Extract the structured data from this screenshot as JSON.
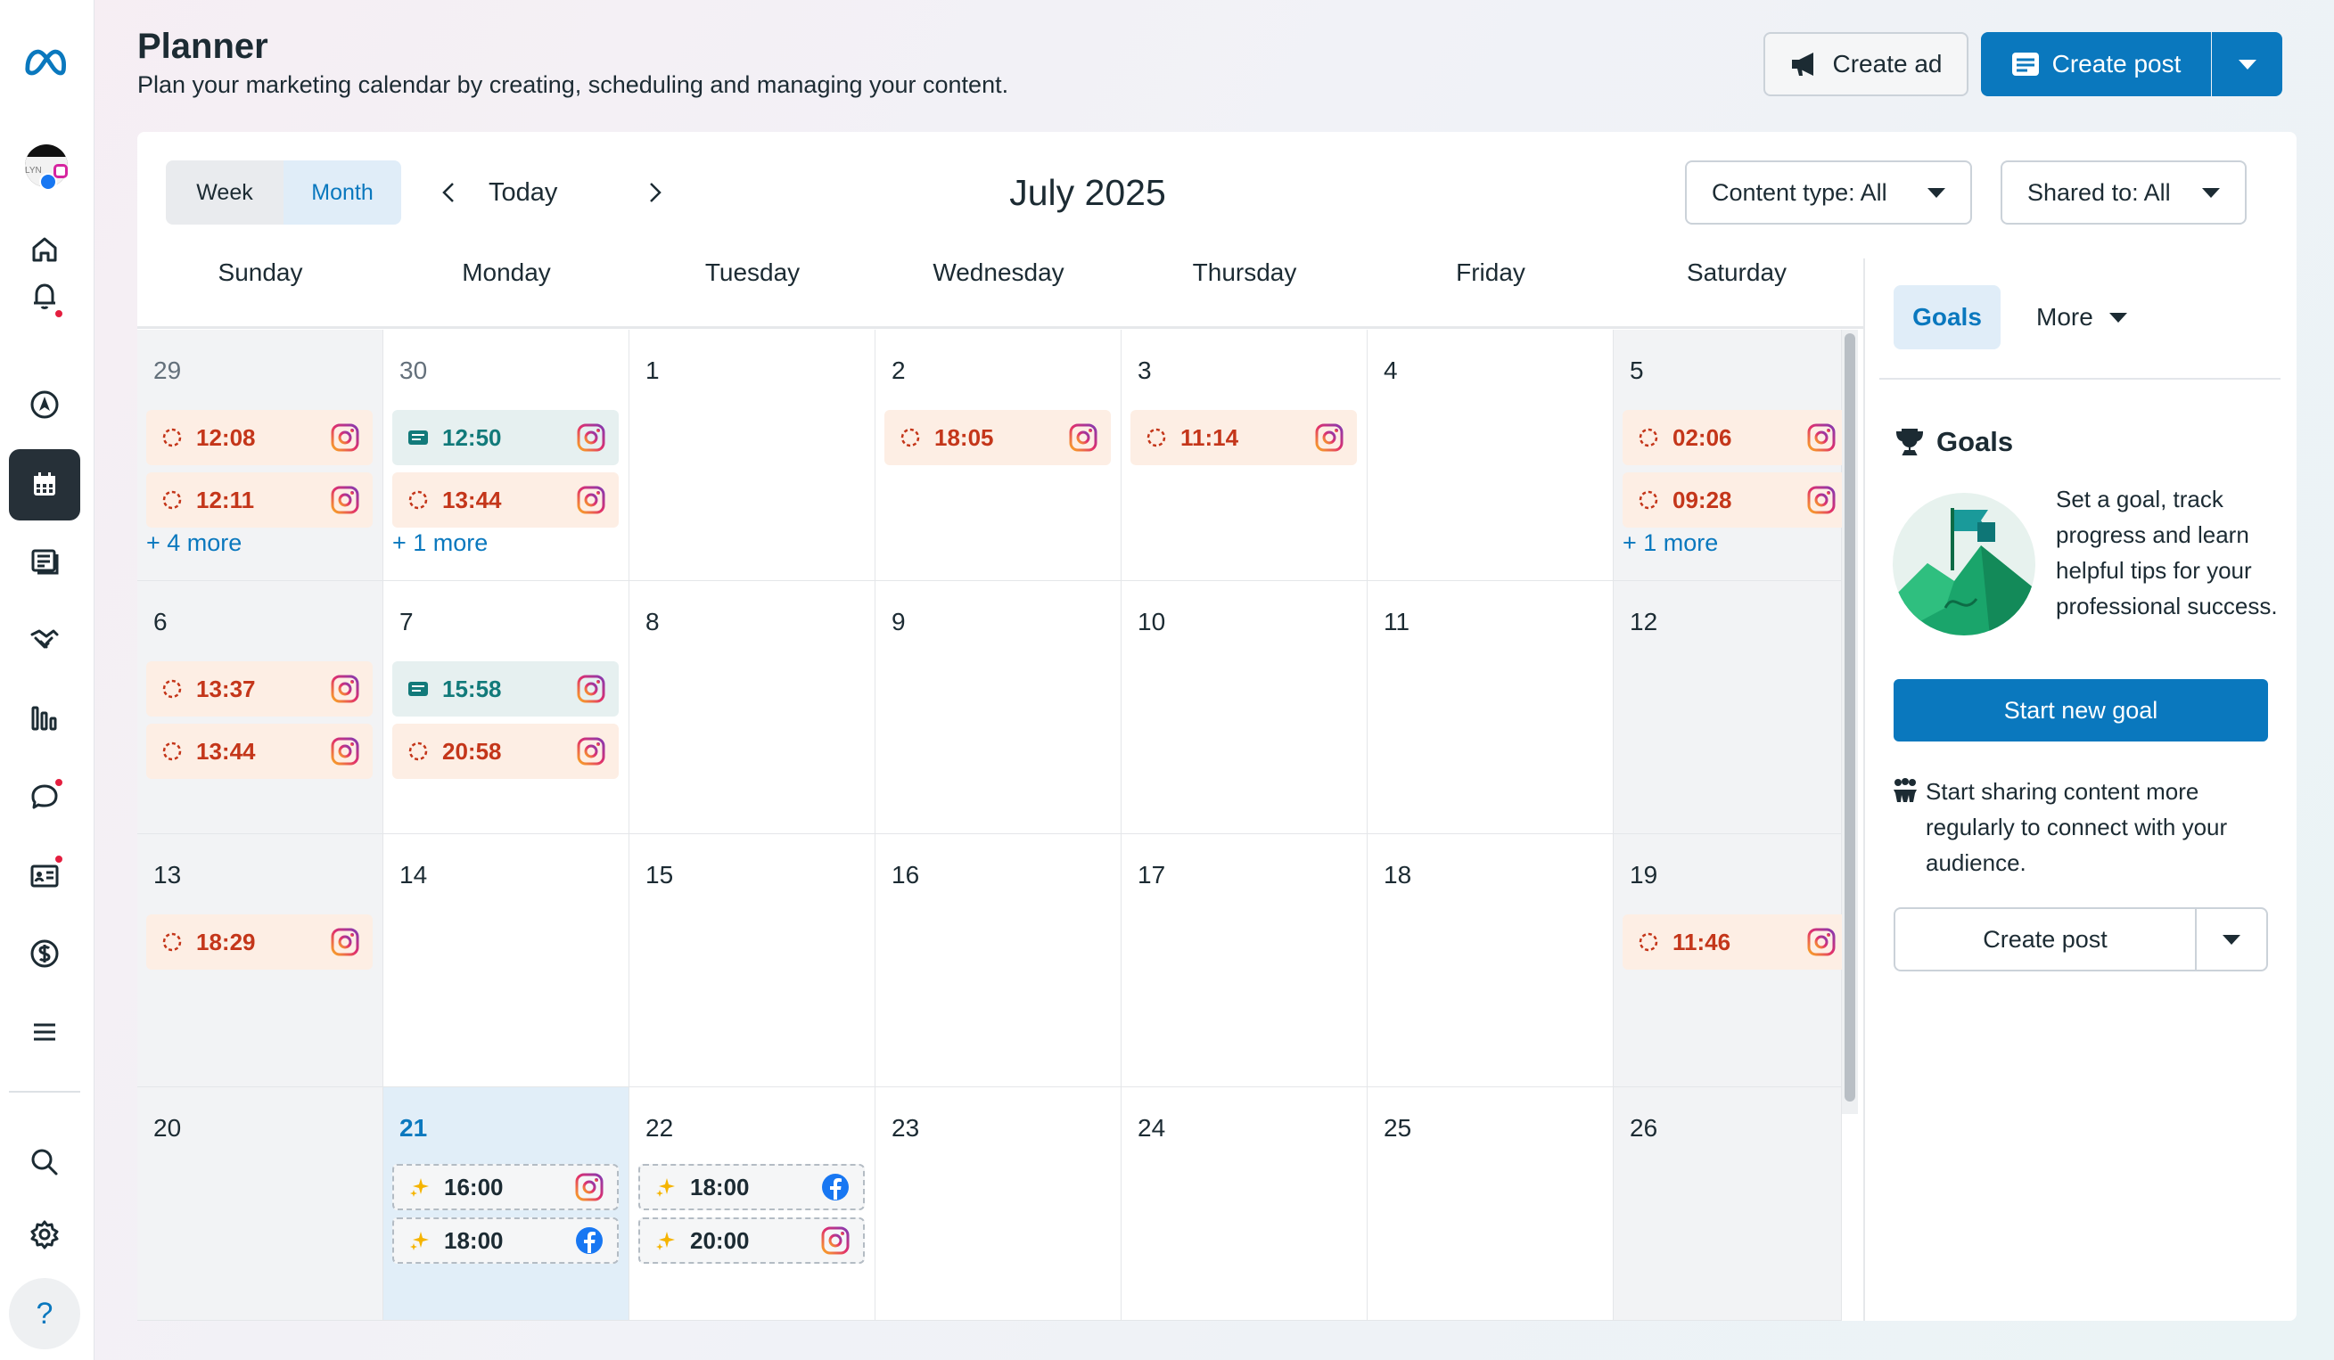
{
  "header": {
    "title": "Planner",
    "subtitle": "Plan your marketing calendar by creating, scheduling and managing your content.",
    "create_ad_label": "Create ad",
    "create_post_label": "Create post"
  },
  "toolbar": {
    "week_label": "Week",
    "month_label": "Month",
    "today_label": "Today",
    "month_title": "July 2025",
    "content_type_label": "Content type: All",
    "shared_to_label": "Shared to: All"
  },
  "days": [
    "Sunday",
    "Monday",
    "Tuesday",
    "Wednesday",
    "Thursday",
    "Friday",
    "Saturday"
  ],
  "weeks": [
    [
      {
        "num": "29",
        "muted": true,
        "chips": [
          {
            "time": "12:08",
            "kind": "draft",
            "net": "ig"
          },
          {
            "time": "12:11",
            "kind": "draft",
            "net": "ig"
          }
        ],
        "more": "+ 4 more"
      },
      {
        "num": "30",
        "muted": true,
        "chips": [
          {
            "time": "12:50",
            "kind": "sched",
            "net": "ig"
          },
          {
            "time": "13:44",
            "kind": "draft",
            "net": "ig"
          }
        ],
        "more": "+ 1 more"
      },
      {
        "num": "1",
        "chips": []
      },
      {
        "num": "2",
        "chips": [
          {
            "time": "18:05",
            "kind": "draft",
            "net": "ig"
          }
        ]
      },
      {
        "num": "3",
        "chips": [
          {
            "time": "11:14",
            "kind": "draft",
            "net": "ig"
          }
        ]
      },
      {
        "num": "4",
        "chips": []
      },
      {
        "num": "5",
        "chips": [
          {
            "time": "02:06",
            "kind": "draft",
            "net": "ig"
          },
          {
            "time": "09:28",
            "kind": "draft",
            "net": "ig"
          }
        ],
        "more": "+ 1 more"
      }
    ],
    [
      {
        "num": "6",
        "chips": [
          {
            "time": "13:37",
            "kind": "draft",
            "net": "ig"
          },
          {
            "time": "13:44",
            "kind": "draft",
            "net": "ig"
          }
        ]
      },
      {
        "num": "7",
        "chips": [
          {
            "time": "15:58",
            "kind": "sched",
            "net": "ig"
          },
          {
            "time": "20:58",
            "kind": "draft",
            "net": "ig"
          }
        ]
      },
      {
        "num": "8",
        "chips": []
      },
      {
        "num": "9",
        "chips": []
      },
      {
        "num": "10",
        "chips": []
      },
      {
        "num": "11",
        "chips": []
      },
      {
        "num": "12",
        "chips": []
      }
    ],
    [
      {
        "num": "13",
        "chips": [
          {
            "time": "18:29",
            "kind": "draft",
            "net": "ig"
          }
        ]
      },
      {
        "num": "14",
        "chips": []
      },
      {
        "num": "15",
        "chips": []
      },
      {
        "num": "16",
        "chips": []
      },
      {
        "num": "17",
        "chips": []
      },
      {
        "num": "18",
        "chips": []
      },
      {
        "num": "19",
        "chips": [
          {
            "time": "11:46",
            "kind": "draft",
            "net": "ig"
          }
        ]
      }
    ],
    [
      {
        "num": "20",
        "chips": []
      },
      {
        "num": "21",
        "today": true,
        "chips": [
          {
            "time": "16:00",
            "kind": "sugg",
            "net": "ig"
          },
          {
            "time": "18:00",
            "kind": "sugg",
            "net": "fb"
          }
        ]
      },
      {
        "num": "22",
        "chips": [
          {
            "time": "18:00",
            "kind": "sugg",
            "net": "fb"
          },
          {
            "time": "20:00",
            "kind": "sugg",
            "net": "ig"
          }
        ]
      },
      {
        "num": "23",
        "chips": []
      },
      {
        "num": "24",
        "chips": []
      },
      {
        "num": "25",
        "chips": []
      },
      {
        "num": "26",
        "chips": []
      }
    ]
  ],
  "sidebar": {
    "goals_tab": "Goals",
    "more_tab": "More",
    "goals_title": "Goals",
    "goals_text": "Set a goal, track progress and learn helpful tips for your professional success.",
    "start_goal_label": "Start new goal",
    "share_text": "Start sharing content more regularly to connect with your audience.",
    "create_post_label": "Create post"
  },
  "rail": {
    "avatar_text": "LYN"
  },
  "colors": {
    "accent": "#0a78be",
    "draft_bg": "#fdeee4",
    "draft_text": "#c4361a",
    "scheduled_bg": "#e6f0f0",
    "scheduled_text": "#127a7a",
    "today_bg": "#e1eef8"
  },
  "icons": [
    "meta-logo-icon",
    "home-icon",
    "bell-icon",
    "compass-icon",
    "calendar-icon",
    "content-icon",
    "handshake-icon",
    "insights-icon",
    "chat-icon",
    "id-card-icon",
    "dollar-icon",
    "menu-icon",
    "search-icon",
    "gear-icon",
    "help-icon",
    "megaphone-icon",
    "post-icon",
    "instagram-icon",
    "facebook-icon",
    "trophy-icon",
    "flag-icon"
  ]
}
